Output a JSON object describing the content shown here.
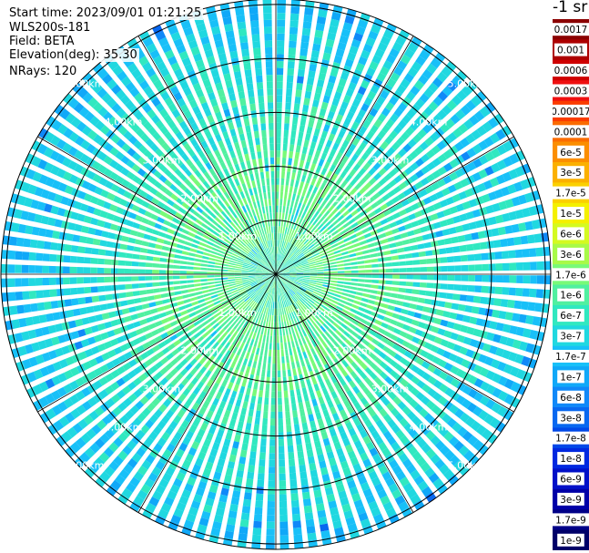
{
  "header": {
    "start_time": "Start time: 2023/09/01 01:21:25",
    "device": "WLS200s-181",
    "field": "Field: BETA",
    "elevation": "Elevation(deg): 35.30",
    "nrays": "NRays: 120"
  },
  "chart_data": {
    "type": "heatmap",
    "projection": "polar-ppi",
    "n_rays": 120,
    "range_rings_km": [
      1,
      2,
      3,
      4,
      5
    ],
    "max_range_km": 5.1,
    "ring_label_format": "{r}.00km",
    "spokes_deg": [
      0,
      30,
      60,
      90,
      120,
      150,
      180,
      210,
      240,
      270,
      300,
      330
    ],
    "colorbar": {
      "unit_label": "-1 sr",
      "labels": [
        "0.0017",
        "0.001",
        "0.0006",
        "0.0003",
        "0.00017",
        "0.0001",
        "6e-5",
        "3e-5",
        "1.7e-5",
        "1e-5",
        "6e-6",
        "3e-6",
        "1.7e-6",
        "1e-6",
        "6e-7",
        "3e-7",
        "1.7e-7",
        "1e-7",
        "6e-8",
        "3e-8",
        "1.7e-8",
        "1e-8",
        "6e-9",
        "3e-9",
        "1.7e-9",
        "1e-9"
      ],
      "colors": [
        "#8b0000",
        "#ad0000",
        "#cf0000",
        "#ef1010",
        "#fb3c00",
        "#fb6c00",
        "#fb8e00",
        "#fbb000",
        "#fbd000",
        "#f4f000",
        "#d4fa20",
        "#a8fa48",
        "#78fa78",
        "#50f0a0",
        "#30e8c0",
        "#20d8e0",
        "#18c0f8",
        "#10a8f8",
        "#1088f8",
        "#0868f0",
        "#0048e8",
        "#0028e0",
        "#0010c8",
        "#0000a8",
        "#000088",
        "#000068"
      ]
    },
    "profile_note": "beta roughly 1e-6 to 3e-6 near the center (green band around 1-2 km), decreasing to about 1e-7 to 3e-7 at outer ranges (cyan/light blue)"
  }
}
